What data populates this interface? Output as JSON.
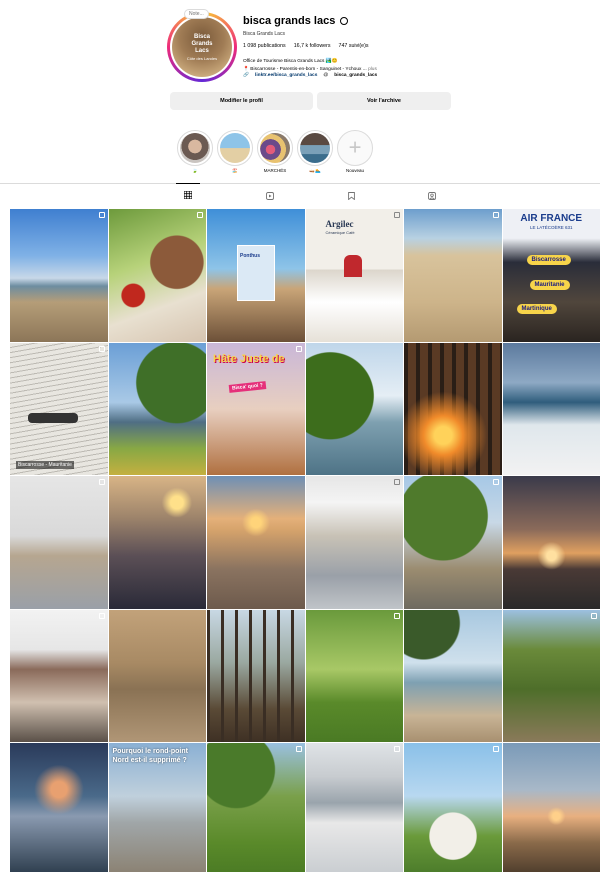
{
  "profile": {
    "note": "Note...",
    "avatar_logo": "Bisca\nGrands\nLacs",
    "avatar_logo_sub": "Côte des Landes",
    "username": "bisca grands lacs",
    "display_name": "Bisca Grands Lacs",
    "stats": {
      "posts": "1 098 publications",
      "followers": "16,7 k followers",
      "following": "747 suivi(e)s"
    },
    "bio_line1": "Office de Tourisme Bisca Grands Lacs 🏞️😊",
    "bio_line2": "📍 Biscarrosse - Parentis-en-born - Sanguinet - Ychoux ...",
    "bio_more": "plus",
    "bio_link": "linktr.ee/bisca_grands_lacs",
    "threads_handle": "bisca_grands_lacs"
  },
  "buttons": {
    "edit_profile": "Modifier le profil",
    "archive": "Voir l'archive"
  },
  "highlights": [
    {
      "label": "🍃"
    },
    {
      "label": "🏖️"
    },
    {
      "label": "MARCHÉS"
    },
    {
      "label": "🛶🏊"
    },
    {
      "label": "Nouveau"
    }
  ],
  "tabs": [
    "posts",
    "reels",
    "saved",
    "tagged"
  ],
  "grid_texts": {
    "p3_title": "Ponthus",
    "p4_title": "Argilec",
    "p4_sub": "Céramique Café",
    "p6_banner": "AIR FRANCE",
    "p6_banner_sub": "LE LATÉCOÈRE 631",
    "p6_tag1": "Biscarrosse",
    "p6_tag2": "Mauritanie",
    "p6_tag3": "Martinique",
    "p7_caption": "Biscarrosse - Mauritanie",
    "p9_head": "Hâte Juste de",
    "p9_sub": "Bisca' quoi ?",
    "p26_text": "Pourquoi le rond-point Nord est-il supprimé ?"
  },
  "colors": {
    "accent_link": "#00376b",
    "button_bg": "#efefef",
    "tag_yellow": "#f7d44a"
  }
}
